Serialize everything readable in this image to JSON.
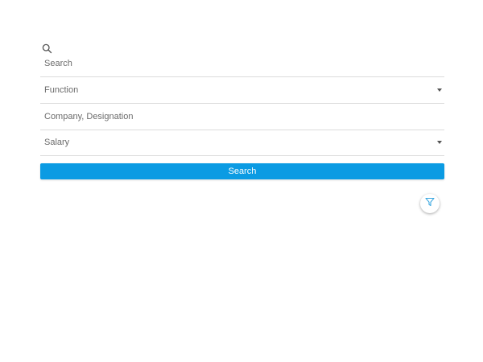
{
  "search": {
    "icon": "search-icon",
    "placeholder": "Search"
  },
  "filters": {
    "function_label": "Function",
    "company_placeholder": "Company, Designation",
    "salary_label": "Salary"
  },
  "actions": {
    "search_button_label": "Search",
    "filter_icon": "filter-icon"
  },
  "colors": {
    "accent": "#0b9be3",
    "filter_icon": "#3aa7e0"
  }
}
